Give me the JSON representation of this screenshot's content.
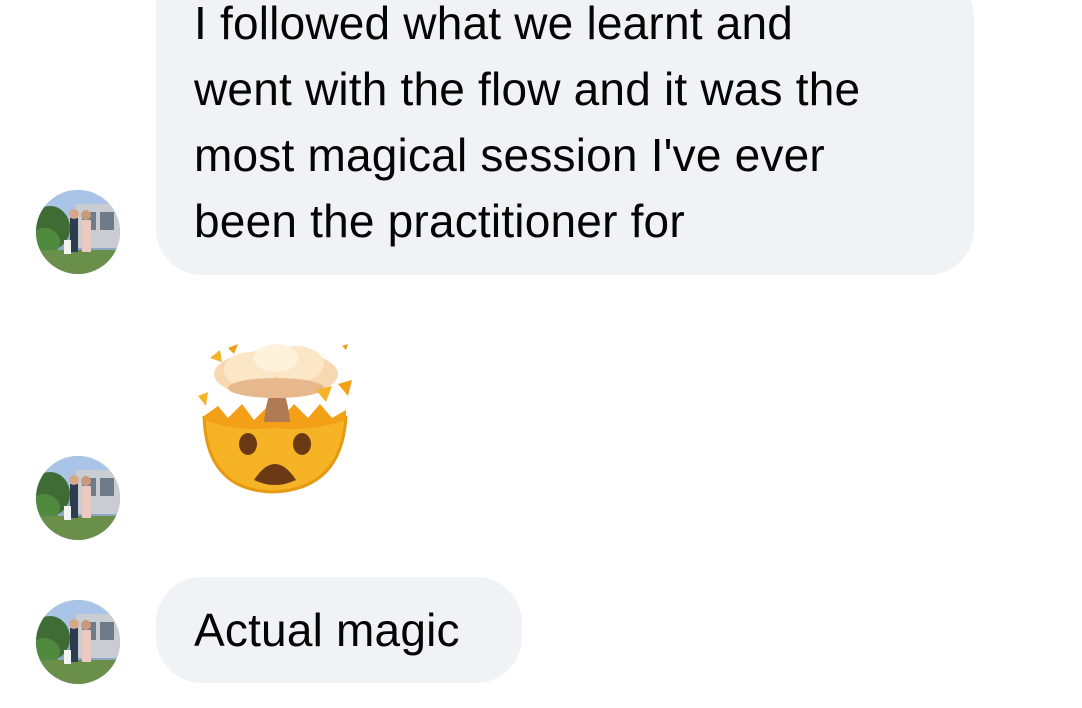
{
  "conversation": {
    "messages": [
      {
        "type": "text",
        "lines": [
          "I followed what we learnt and",
          "went with the flow and it was the",
          "most magical session I've ever",
          "been the practitioner for"
        ]
      },
      {
        "type": "emoji",
        "emoji": "exploding-head-emoji"
      },
      {
        "type": "text",
        "text": "Actual magic"
      }
    ]
  },
  "colors": {
    "bubble_background": "#f1f2f6",
    "text": "#050505",
    "page_background": "#ffffff"
  }
}
